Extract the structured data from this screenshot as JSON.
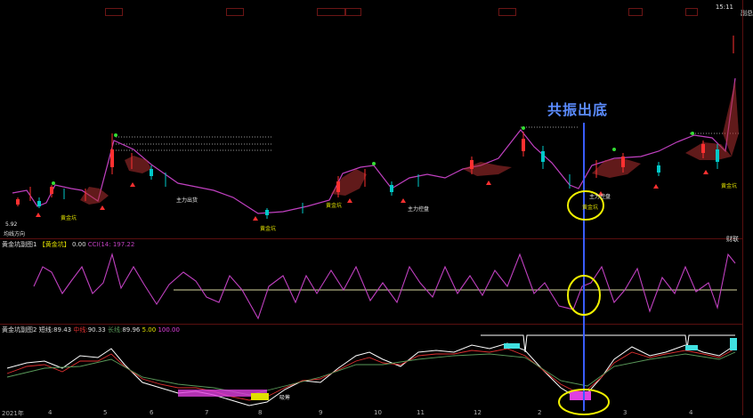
{
  "header": {
    "right_label": "副总",
    "time_label": "15:11"
  },
  "price_panel": {
    "start_price": "5.92",
    "side_text": "均线方向"
  },
  "labels": {
    "gold_pit": "黄金坑",
    "main_shipment": "主力出货",
    "main_control": "主力控盘",
    "resonance": "共振出底"
  },
  "indicator1": {
    "title": "黄金坑副图1",
    "bracket": "【黄金坑】",
    "val1": "0.00",
    "cci": "CCI(14: 197.22",
    "right_tag": "财联"
  },
  "indicator2": {
    "title": "黄金坑副图2",
    "short_label": "短线:",
    "short_val": "89.43",
    "mid_label": "中线:",
    "mid_val": "90.33",
    "long_label": "长线:",
    "long_val": "89.96",
    "v1": "5.00",
    "v2": "100.00",
    "pit_label": "吸筹"
  },
  "xaxis": [
    "2021年",
    "4",
    "5",
    "6",
    "7",
    "8",
    "9",
    "10",
    "11",
    "12",
    "2",
    "3",
    "4"
  ],
  "colors": {
    "price_line": "#c040c0",
    "resonance_line": "#3a5dff",
    "circle": "#f0f000",
    "up": "#ff3030",
    "down": "#00c8c8"
  }
}
